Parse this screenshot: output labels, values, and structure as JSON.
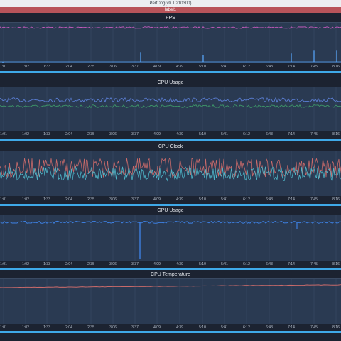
{
  "window": {
    "title": "PerfDog(v0.1.210300)"
  },
  "label_bar": {
    "text": "label1"
  },
  "time_ticks": [
    "1:01",
    "1:02",
    "1:33",
    "2:04",
    "2:35",
    "3:06",
    "3:37",
    "4:09",
    "4:39",
    "5:10",
    "5:41",
    "6:12",
    "6:43",
    "7:14",
    "7:45",
    "8:16"
  ],
  "colors": {
    "fps_line": "#c85bbf",
    "cpu_line_1": "#5b7fd6",
    "cpu_line_2": "#3e9a6a",
    "clock_line_1": "#c96a6a",
    "clock_line_2": "#4fb6c8",
    "gpu_line": "#3d7fe0",
    "temp_line": "#c96a6a",
    "spike": "#58a8ff",
    "scrollbar": "#3fa9e8",
    "plot_bg": "#2a3a52"
  },
  "panels": [
    {
      "id": "fps",
      "title": "FPS"
    },
    {
      "id": "cpu-usage",
      "title": "CPU Usage"
    },
    {
      "id": "cpu-clock",
      "title": "CPU Clock"
    },
    {
      "id": "gpu-usage",
      "title": "GPU Usage"
    },
    {
      "id": "cpu-temperature",
      "title": "CPU Temperature"
    }
  ]
}
